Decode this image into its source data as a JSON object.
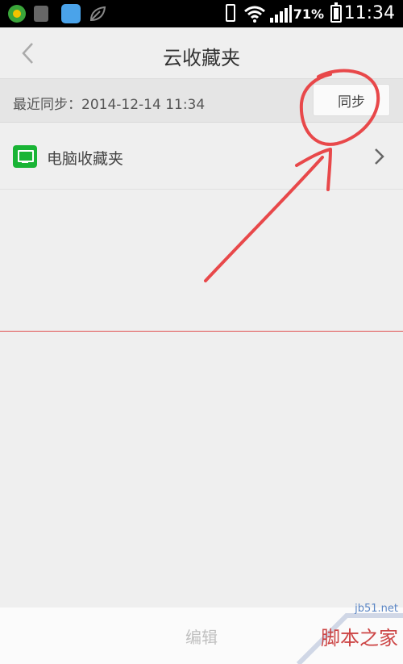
{
  "status_bar": {
    "battery_percent": "71%",
    "time": "11:34",
    "icons": [
      "app-green-icon",
      "app-gray-icon",
      "app-blue-icon",
      "leaf-icon",
      "phone-vibrate-icon",
      "wifi-icon",
      "signal-icon",
      "battery-icon"
    ]
  },
  "header": {
    "title": "云收藏夹",
    "back_icon": "chevron-left-icon"
  },
  "sync": {
    "last_sync": "最近同步：2014-12-14 11:34",
    "button_label": "同步"
  },
  "list": {
    "items": [
      {
        "label": "电脑收藏夹",
        "icon": "monitor-icon"
      }
    ]
  },
  "footer": {
    "edit_label": "编辑"
  },
  "watermark": {
    "url": "jb51.net",
    "text": "脚本之家"
  },
  "colors": {
    "annotation": "#e8484a",
    "pc_icon": "#19b435",
    "background": "#efefef"
  }
}
